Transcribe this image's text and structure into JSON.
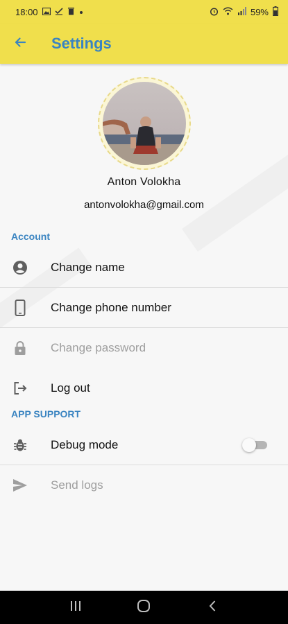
{
  "status_bar": {
    "time": "18:00",
    "battery": "59%",
    "left_icons": [
      "gallery-icon",
      "check-download-icon",
      "trash-icon",
      "dot-icon"
    ],
    "right_icons": [
      "alarm-icon",
      "wifi-icon",
      "signal-icon",
      "battery-icon"
    ]
  },
  "app_bar": {
    "title": "Settings",
    "back_icon": "arrow-left-icon"
  },
  "colors": {
    "app_bar": "#f0df4c",
    "accent": "#3a84c1",
    "text": "#111111",
    "disabled_text": "#9e9e9e"
  },
  "profile": {
    "name": "Anton Volokha",
    "email": "antonvolokha@gmail.com"
  },
  "sections": {
    "account": {
      "title": "Account",
      "items": [
        {
          "label": "Change name",
          "icon": "account-circle-icon",
          "enabled": true
        },
        {
          "label": "Change phone number",
          "icon": "smartphone-icon",
          "enabled": true
        },
        {
          "label": "Change password",
          "icon": "lock-icon",
          "enabled": false
        },
        {
          "label": "Log out",
          "icon": "logout-icon",
          "enabled": true
        }
      ]
    },
    "app_support": {
      "title": "APP SUPPORT",
      "items": [
        {
          "label": "Debug mode",
          "icon": "bug-icon",
          "enabled": true,
          "toggle": false
        },
        {
          "label": "Send logs",
          "icon": "send-icon",
          "enabled": false
        }
      ]
    }
  },
  "nav_bar": {
    "buttons": [
      "recents-icon",
      "home-icon",
      "back-icon"
    ]
  }
}
